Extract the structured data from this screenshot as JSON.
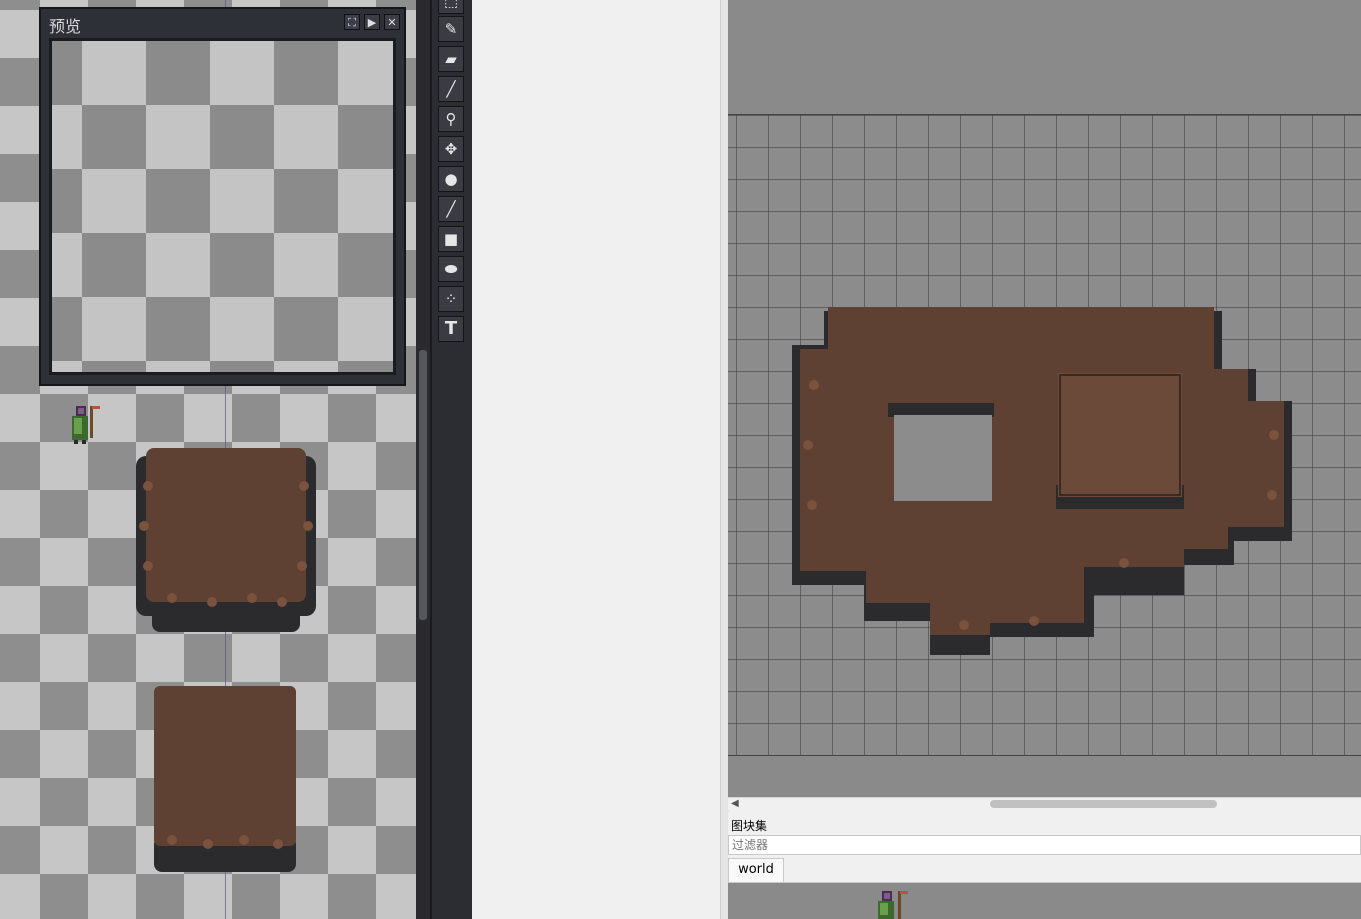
{
  "preview_panel": {
    "title": "预览",
    "buttons": [
      "maximize",
      "play",
      "close"
    ]
  },
  "toolbar": {
    "tools": [
      "rect-select-icon",
      "pencil-icon",
      "eraser-icon",
      "brush-icon",
      "magnifier-icon",
      "move-icon",
      "fill-icon",
      "line-icon",
      "rectangle-icon",
      "ellipse-icon",
      "spray-icon",
      "text-icon"
    ],
    "text_tool_glyph": "T"
  },
  "tileset_panel": {
    "title": "图块集",
    "filter_placeholder": "过滤器",
    "tabs": [
      "world"
    ]
  },
  "colors": {
    "dirt": "#5e4133",
    "rock": "#2b2b2d",
    "panel_dark": "#2e3038",
    "map_background": "#8a8a8a"
  }
}
